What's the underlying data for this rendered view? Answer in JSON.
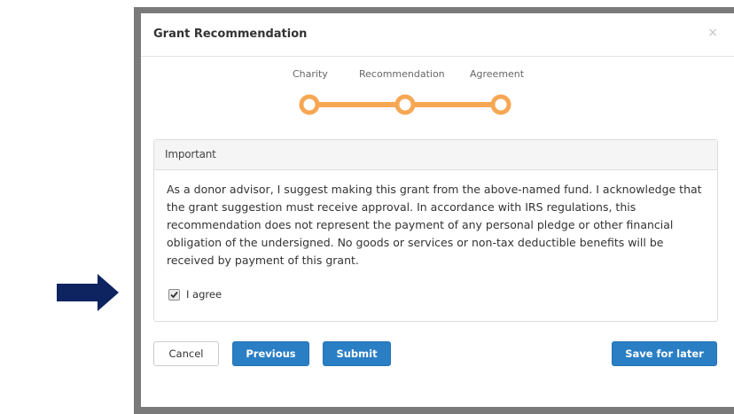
{
  "modal": {
    "title": "Grant Recommendation",
    "close_glyph": "×"
  },
  "stepper": {
    "steps": [
      {
        "label": "Charity"
      },
      {
        "label": "Recommendation"
      },
      {
        "label": "Agreement"
      }
    ],
    "color": "#f7a754"
  },
  "panel": {
    "heading": "Important",
    "body": "As a donor advisor, I suggest making this grant from the above-named fund. I acknowledge that the grant suggestion must receive approval. In accordance with IRS regulations, this recommendation does not represent the payment of any personal pledge or other financial obligation of the undersigned. No goods or services or non-tax deductible benefits will be received by payment of this grant.",
    "agree_label": "I agree",
    "agree_checked": true
  },
  "buttons": {
    "cancel": "Cancel",
    "previous": "Previous",
    "submit": "Submit",
    "save_later": "Save for later"
  },
  "colors": {
    "primary": "#2a7ec4",
    "arrow": "#0d2461",
    "frame": "#7a7a7a"
  }
}
